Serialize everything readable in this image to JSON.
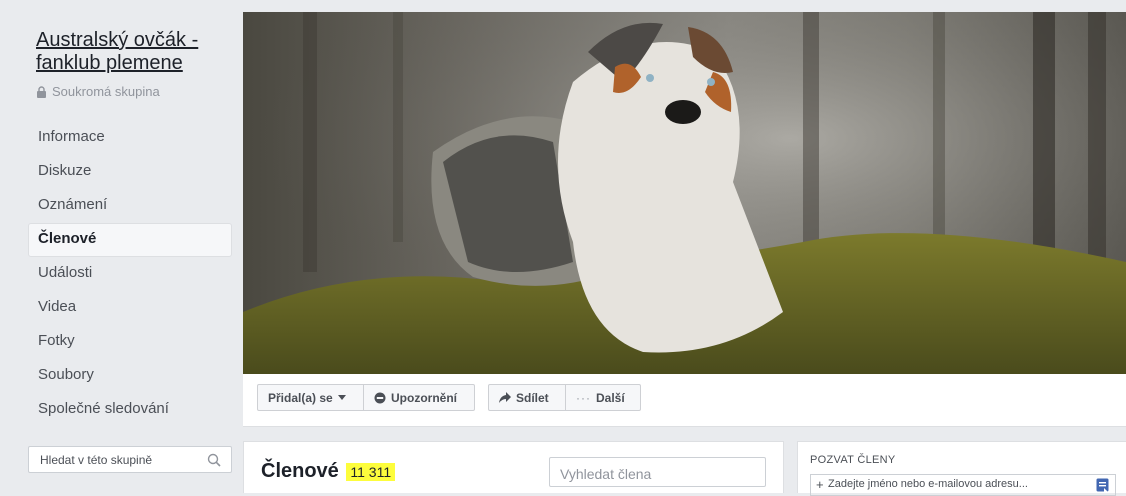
{
  "group": {
    "title": "Australský ovčák - fanklub plemene",
    "privacy": "Soukromá skupina"
  },
  "nav": {
    "items": [
      "Informace",
      "Diskuze",
      "Oznámení",
      "Členové",
      "Události",
      "Videa",
      "Fotky",
      "Soubory",
      "Společné sledování"
    ],
    "active": "Členové"
  },
  "group_search": {
    "placeholder": "Hledat v této skupině"
  },
  "actions": {
    "joined": "Přidal(a) se",
    "notifications": "Upozornění",
    "share": "Sdílet",
    "more": "Další"
  },
  "members": {
    "title": "Členové",
    "count": "11 311",
    "search_placeholder": "Vyhledat člena"
  },
  "invite": {
    "title": "POZVAT ČLENY",
    "placeholder": "Zadejte jméno nebo e-mailovou adresu..."
  },
  "icons": [
    "lock-icon",
    "search-icon",
    "caret-down-icon",
    "bell-off-icon",
    "share-arrow-icon",
    "more-dots-icon",
    "plus-icon",
    "address-book-icon"
  ],
  "colors": {
    "background": "#e9ebee",
    "highlight": "#fdfd3c",
    "link": "#4267b2"
  }
}
